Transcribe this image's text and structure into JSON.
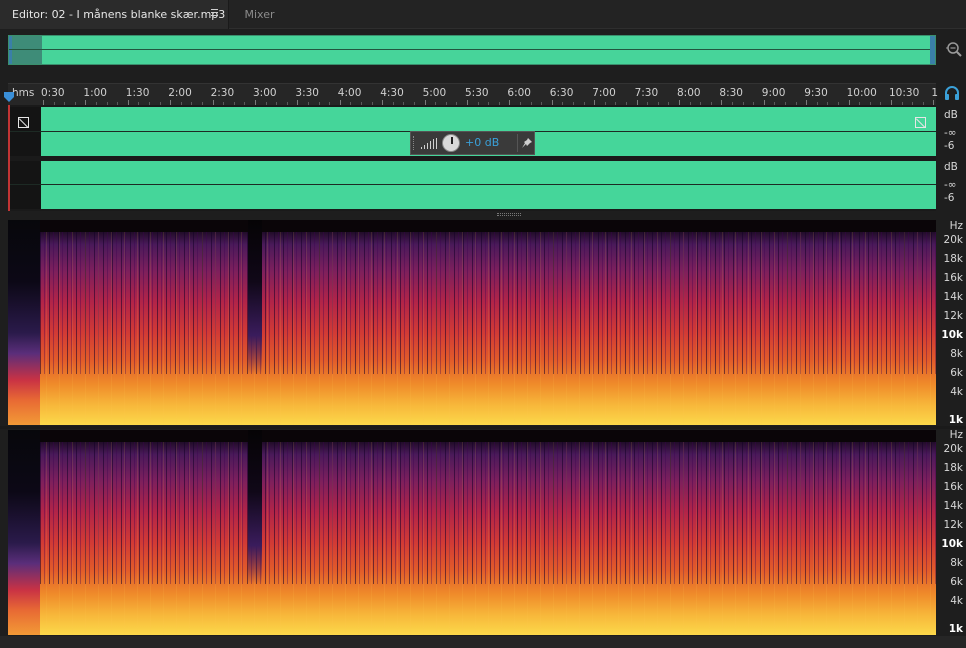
{
  "tabs": {
    "editor_label": "Editor: 02 - I månens blanke skær.mp3",
    "mixer_label": "Mixer"
  },
  "ruler": {
    "unit_label": "hms",
    "labels": [
      "0:30",
      "1:00",
      "1:30",
      "2:00",
      "2:30",
      "3:00",
      "3:30",
      "4:00",
      "4:30",
      "5:00",
      "5:30",
      "6:00",
      "6:30",
      "7:00",
      "7:30",
      "8:00",
      "8:30",
      "9:00",
      "9:30",
      "10:00",
      "10:30",
      "1"
    ]
  },
  "hud": {
    "volume_value": "+0 dB"
  },
  "db_scale": {
    "ch1": [
      "dB",
      "-∞",
      "-6"
    ],
    "ch2": [
      "dB",
      "-∞",
      "-6"
    ]
  },
  "hz_scale": {
    "labels": [
      "Hz",
      "20k",
      "18k",
      "16k",
      "14k",
      "12k",
      "10k",
      "8k",
      "6k",
      "4k",
      "1k"
    ]
  },
  "colors": {
    "waveform": "#45d69a",
    "accent": "#3aa0d8",
    "background": "#1e1e1e"
  },
  "icons": {
    "zoom": "zoom-icon",
    "headphones": "headphones-icon",
    "pin": "pin-icon",
    "menu": "menu-icon"
  }
}
